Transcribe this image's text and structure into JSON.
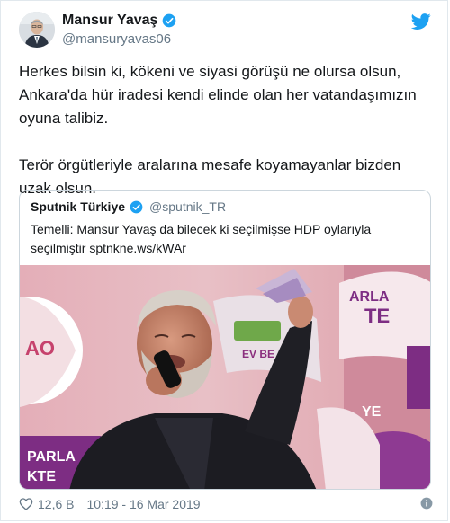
{
  "author": {
    "name": "Mansur Yavaş",
    "handle": "@mansuryavas06"
  },
  "tweet": {
    "paragraph1": "Herkes bilsin ki, kökeni ve siyasi görüşü ne olursa olsun, Ankara'da hür iradesi kendi elinde olan her vatandaşımızın oyuna talibiz.",
    "paragraph2": "Terör örgütleriyle aralarına mesafe koyamayanlar bizden uzak olsun."
  },
  "quoted": {
    "name": "Sputnik Türkiye",
    "handle": "@sputnik_TR",
    "text": "Temelli: Mansur Yavaş da bilecek ki seçilmişse HDP oylarıyla seçilmiştir sptnkne.ws/kWAr",
    "image_sign_texts": [
      "AO",
      "EV BE",
      "ARLA",
      "TE",
      "PARLA",
      "KTE",
      "YE"
    ]
  },
  "footer": {
    "likes": "12,6 B",
    "timestamp": "10:19 - 16 Mar 2019"
  },
  "colors": {
    "twitter_blue": "#1da1f2",
    "verified": "#1da1f2",
    "muted": "#657786",
    "hdp_purple": "#7d2d83"
  },
  "icons": [
    "verified-badge-icon",
    "twitter-bird-icon",
    "heart-icon",
    "info-icon"
  ]
}
